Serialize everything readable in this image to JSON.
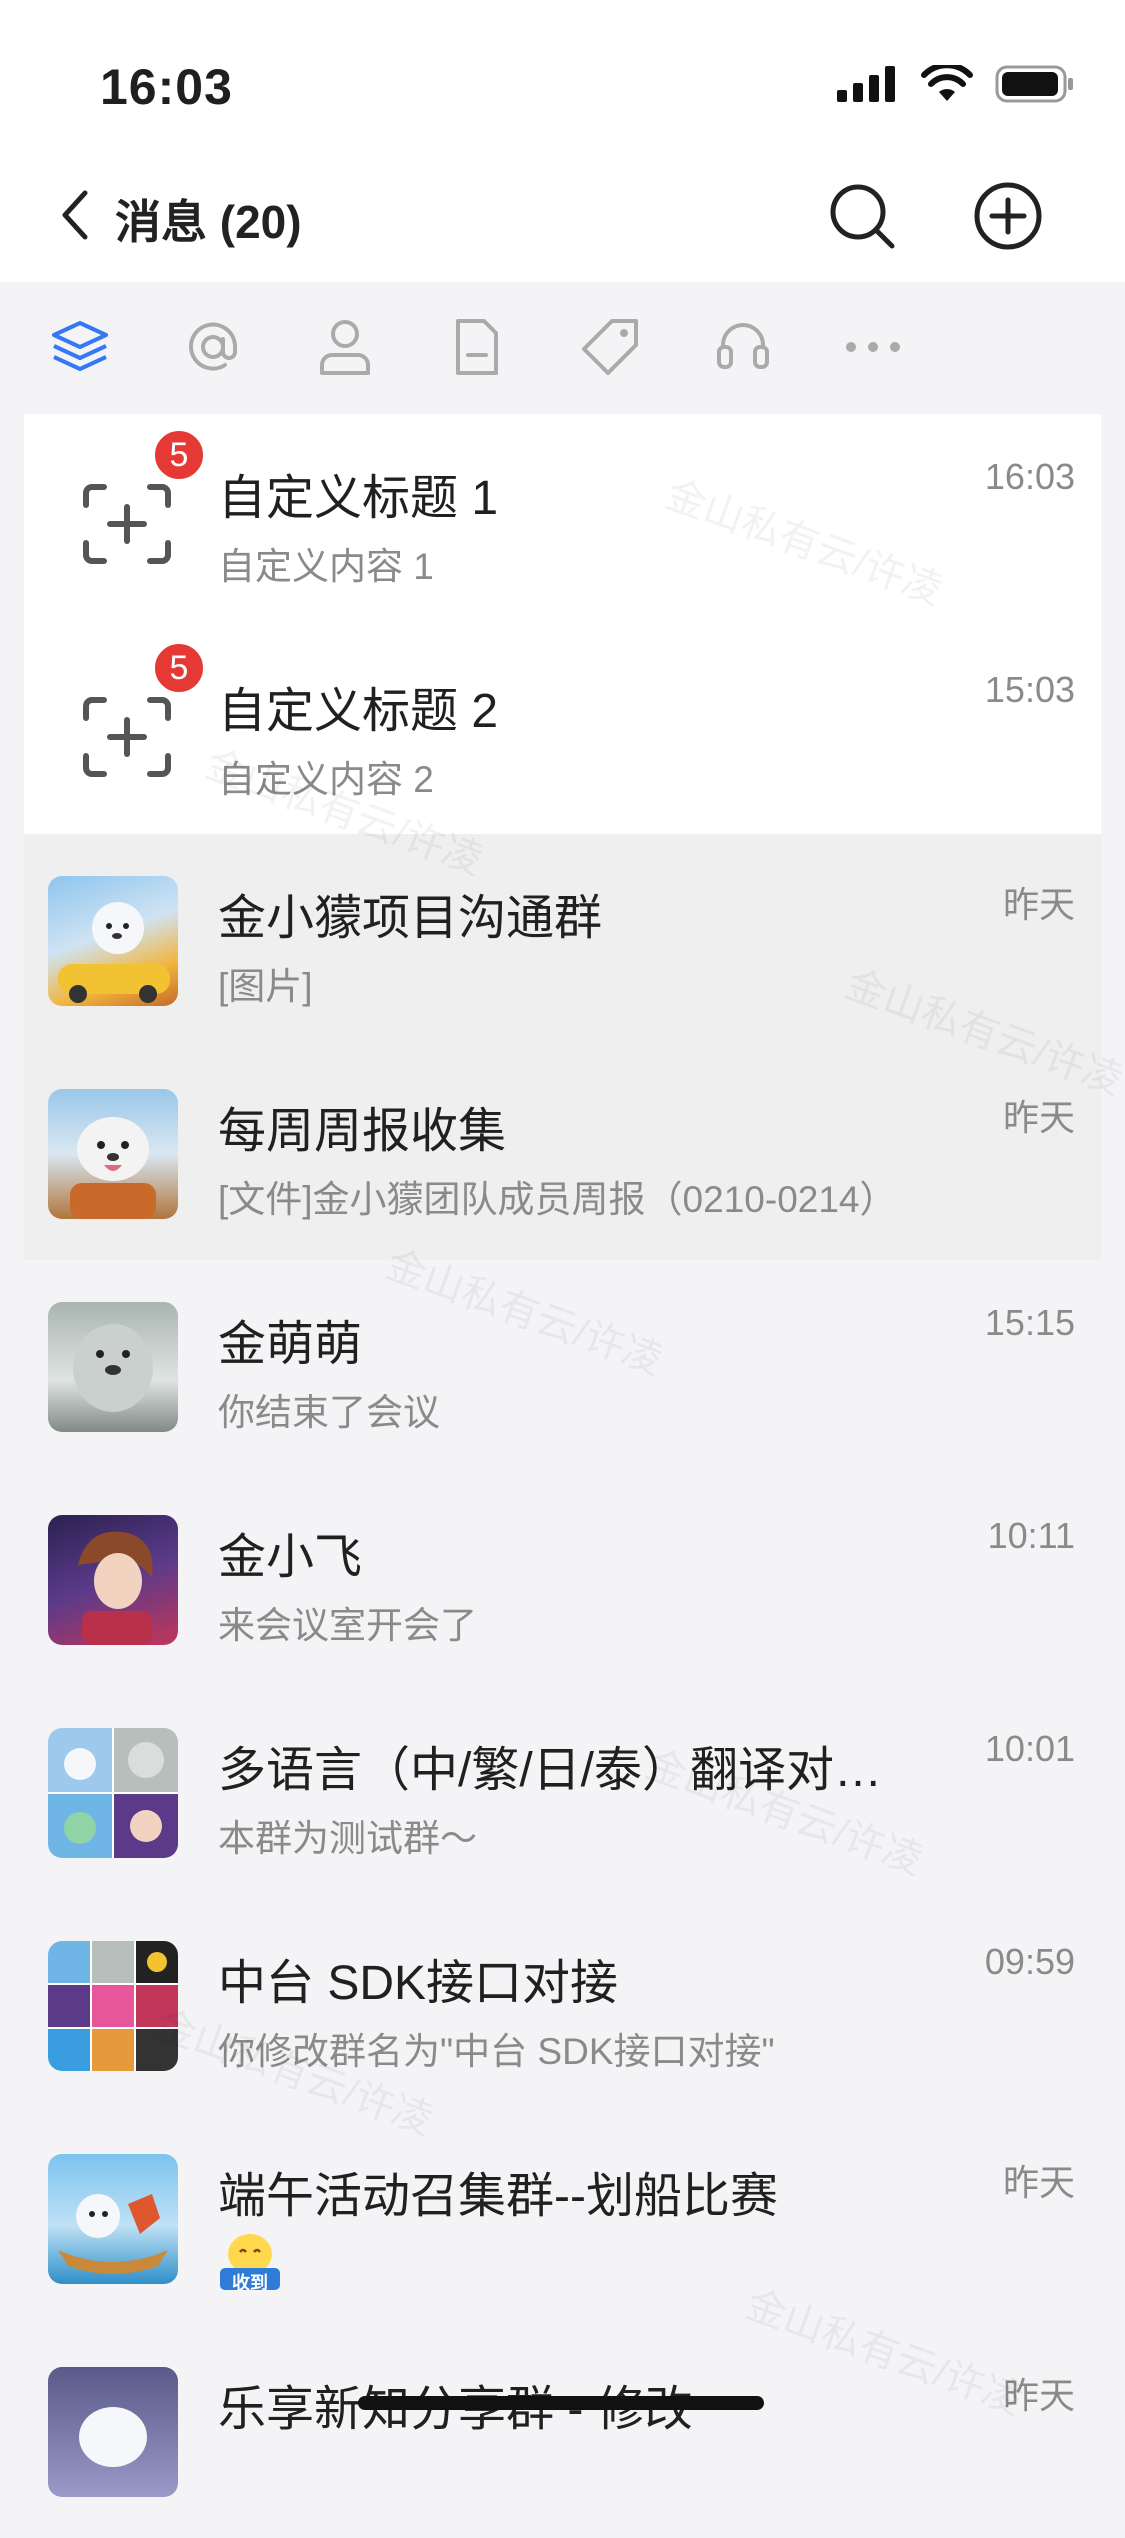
{
  "status_bar": {
    "time": "16:03"
  },
  "nav": {
    "title": "消息 (20)"
  },
  "filter_tabs": [
    {
      "icon": "layers-icon",
      "active": true
    },
    {
      "icon": "at-icon",
      "active": false
    },
    {
      "icon": "person-icon",
      "active": false
    },
    {
      "icon": "document-icon",
      "active": false
    },
    {
      "icon": "tag-icon",
      "active": false
    },
    {
      "icon": "headset-icon",
      "active": false
    },
    {
      "icon": "more-icon",
      "active": false
    }
  ],
  "conversations": [
    {
      "title": "自定义标题 1",
      "subtitle": "自定义内容 1",
      "time": "16:03",
      "badge": "5",
      "avatar": "custom-icon"
    },
    {
      "title": "自定义标题 2",
      "subtitle": "自定义内容 2",
      "time": "15:03",
      "badge": "5",
      "avatar": "custom-icon"
    },
    {
      "title": "金小獴项目沟通群",
      "subtitle": "[图片]",
      "time": "昨天",
      "avatar": "group-avatar"
    },
    {
      "title": "每周周报收集",
      "subtitle": "[文件]金小獴团队成员周报（0210-0214）",
      "time": "昨天",
      "avatar": "group-avatar"
    },
    {
      "title": "金萌萌",
      "subtitle": "你结束了会议",
      "time": "15:15",
      "avatar": "user-avatar"
    },
    {
      "title": "金小飞",
      "subtitle": "来会议室开会了",
      "time": "10:11",
      "avatar": "user-avatar"
    },
    {
      "title": "多语言（中/繁/日/泰）翻译对…",
      "subtitle": "本群为测试群～",
      "time": "10:01",
      "avatar": "group-avatar"
    },
    {
      "title": "中台 SDK接口对接",
      "subtitle": "你修改群名为\"中台 SDK接口对接\"",
      "time": "09:59",
      "avatar": "group-avatar"
    },
    {
      "title": "端午活动召集群--划船比赛",
      "subtitle": "",
      "time": "昨天",
      "avatar": "group-avatar",
      "sticker": "收到"
    },
    {
      "title": "乐享新知分享群 - 修改",
      "subtitle": "",
      "time": "昨天",
      "avatar": "group-avatar"
    }
  ],
  "watermark": "金山私有云/许凌",
  "colors": {
    "accent": "#3478f6",
    "badge": "#e53935",
    "pinned_bg": "#ffffff",
    "highlight_bg": "#efefef"
  }
}
